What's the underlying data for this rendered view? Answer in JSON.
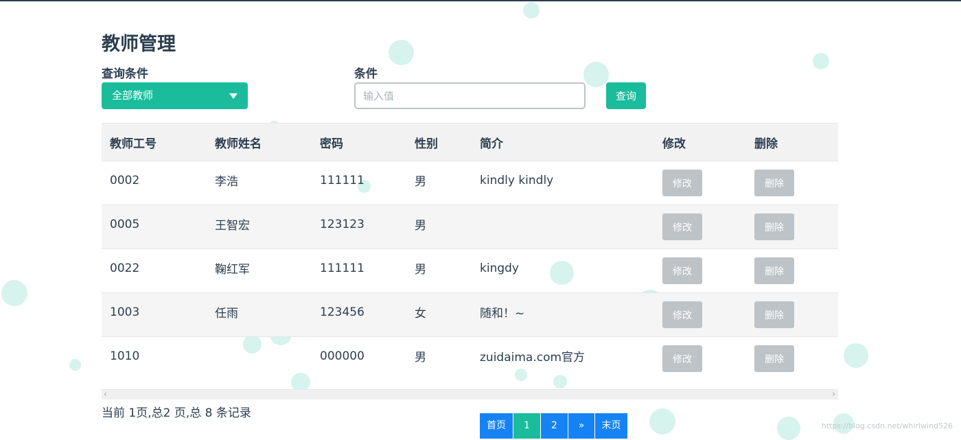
{
  "page": {
    "title": "教师管理"
  },
  "filter": {
    "query_condition_label": "查询条件",
    "query_condition_value": "全部教师",
    "condition_label": "条件",
    "condition_placeholder": "输入值",
    "query_button": "查询"
  },
  "table": {
    "headers": [
      "教师工号",
      "教师姓名",
      "密码",
      "性别",
      "简介",
      "修改",
      "删除"
    ],
    "rows": [
      {
        "id": "0002",
        "name": "李浩",
        "password": "111111",
        "gender": "男",
        "intro": "kindly kindly",
        "edit": "修改",
        "delete": "删除"
      },
      {
        "id": "0005",
        "name": "王智宏",
        "password": "123123",
        "gender": "男",
        "intro": "",
        "edit": "修改",
        "delete": "删除"
      },
      {
        "id": "0022",
        "name": "鞠红军",
        "password": "111111",
        "gender": "男",
        "intro": "kingdy",
        "edit": "修改",
        "delete": "删除"
      },
      {
        "id": "1003",
        "name": "任雨",
        "password": "123456",
        "gender": "女",
        "intro": "随和！~",
        "edit": "修改",
        "delete": "删除"
      },
      {
        "id": "1010",
        "name": "",
        "password": "000000",
        "gender": "男",
        "intro": "zuidaima.com官方",
        "edit": "修改",
        "delete": "删除"
      }
    ]
  },
  "footer": {
    "page_info": "当前 1页,总2 页,总 8 条记录",
    "pagination": {
      "first": "首页",
      "page1": "1",
      "page2": "2",
      "next": "»",
      "last": "末页"
    },
    "watermark": "https://blog.csdn.net/whirlwind526"
  },
  "colors": {
    "accent": "#1abc9c",
    "pagination_blue": "#1683f5",
    "disabled_button": "#bdc3c7",
    "text": "#2c3e50"
  },
  "icons": {
    "select_arrow": "caret-down-icon",
    "scroll_left": "chevron-left-icon",
    "scroll_right": "chevron-right-icon"
  }
}
